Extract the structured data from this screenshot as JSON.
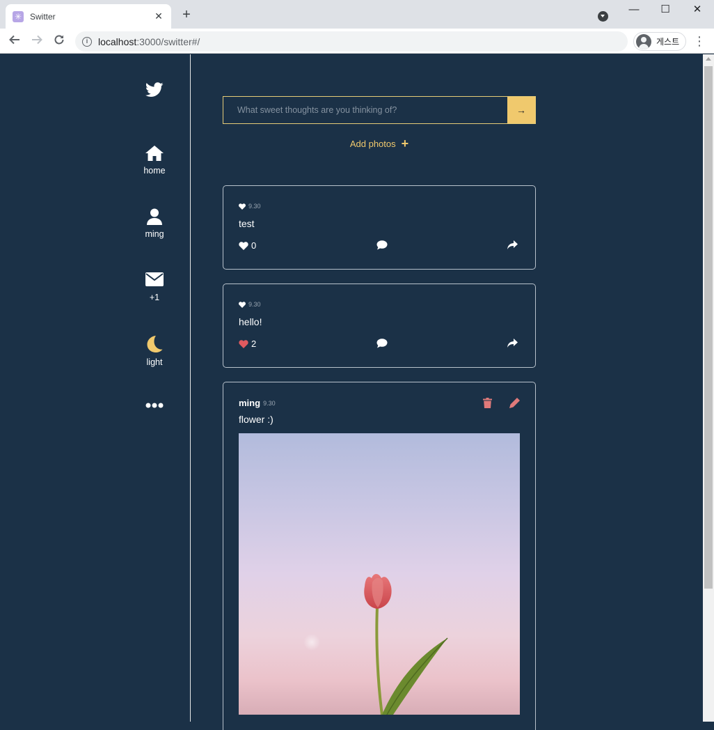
{
  "browser": {
    "tab_title": "Switter",
    "tab_favicon": "✳",
    "url_host": "localhost",
    "url_path": ":3000/switter#/",
    "profile_label": "게스트"
  },
  "sidebar": {
    "items": [
      {
        "icon": "twitter-logo-icon",
        "label": ""
      },
      {
        "icon": "home-icon",
        "label": "home"
      },
      {
        "icon": "user-icon",
        "label": "ming"
      },
      {
        "icon": "envelope-icon",
        "label": "+1"
      },
      {
        "icon": "moon-icon",
        "label": "light"
      },
      {
        "icon": "more-icon",
        "label": ""
      }
    ]
  },
  "compose": {
    "placeholder": "What sweet thoughts are you thinking of?",
    "submit_label": "→",
    "add_photos_label": "Add photos",
    "add_photos_icon": "+"
  },
  "posts": [
    {
      "date": "9.30",
      "text": "test",
      "likes": "0",
      "liked": false
    },
    {
      "date": "9.30",
      "text": "hello!",
      "likes": "2",
      "liked": true
    },
    {
      "author": "ming",
      "date": "9.30",
      "text": "flower :)",
      "has_image": true,
      "image_subject": "pink tulip against pastel sky"
    }
  ],
  "colors": {
    "background": "#1b3147",
    "accent": "#f0c96d",
    "liked": "#e05a5f",
    "delete": "#e07a7a",
    "edit": "#e07a7a"
  }
}
